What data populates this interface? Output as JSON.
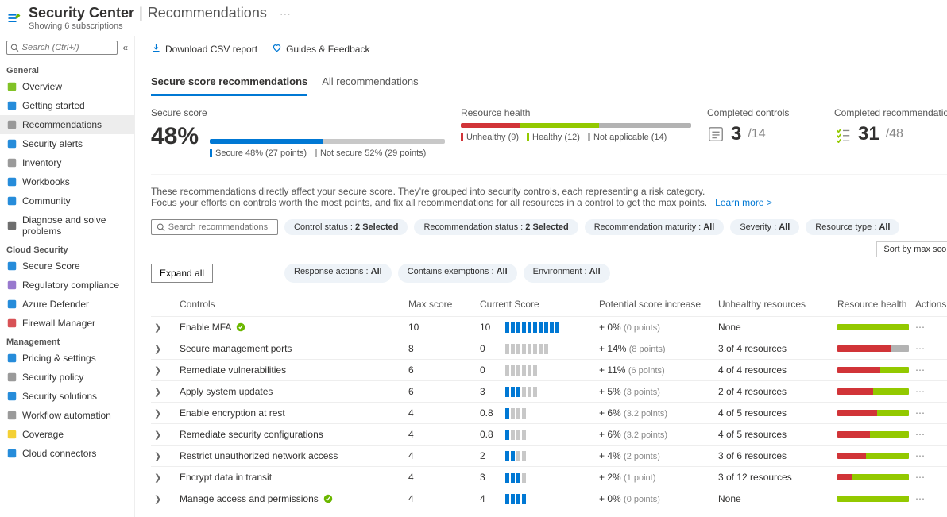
{
  "header": {
    "product": "Security Center",
    "page": "Recommendations",
    "subtitle": "Showing 6 subscriptions"
  },
  "search": {
    "placeholder": "Search (Ctrl+/)"
  },
  "sidebar": {
    "groups": [
      {
        "label": "General",
        "items": [
          {
            "label": "Overview",
            "icon": "shield",
            "color": "#6bb700"
          },
          {
            "label": "Getting started",
            "icon": "rocket",
            "color": "#0078d4"
          },
          {
            "label": "Recommendations",
            "icon": "list",
            "color": "#888",
            "active": true
          },
          {
            "label": "Security alerts",
            "icon": "shield-alert",
            "color": "#0078d4"
          },
          {
            "label": "Inventory",
            "icon": "box",
            "color": "#888"
          },
          {
            "label": "Workbooks",
            "icon": "book",
            "color": "#0078d4"
          },
          {
            "label": "Community",
            "icon": "people",
            "color": "#0078d4"
          },
          {
            "label": "Diagnose and solve problems",
            "icon": "wrench",
            "color": "#555"
          }
        ]
      },
      {
        "label": "Cloud Security",
        "items": [
          {
            "label": "Secure Score",
            "icon": "shield-check",
            "color": "#0078d4"
          },
          {
            "label": "Regulatory compliance",
            "icon": "badge",
            "color": "#8661c5"
          },
          {
            "label": "Azure Defender",
            "icon": "defender",
            "color": "#0078d4"
          },
          {
            "label": "Firewall Manager",
            "icon": "firewall",
            "color": "#d13438"
          }
        ]
      },
      {
        "label": "Management",
        "items": [
          {
            "label": "Pricing & settings",
            "icon": "sliders",
            "color": "#0078d4"
          },
          {
            "label": "Security policy",
            "icon": "gear",
            "color": "#888"
          },
          {
            "label": "Security solutions",
            "icon": "grid",
            "color": "#0078d4"
          },
          {
            "label": "Workflow automation",
            "icon": "flow",
            "color": "#888"
          },
          {
            "label": "Coverage",
            "icon": "coverage",
            "color": "#f2c811"
          },
          {
            "label": "Cloud connectors",
            "icon": "cloud",
            "color": "#0078d4"
          }
        ]
      }
    ]
  },
  "toolbar": {
    "download": "Download CSV report",
    "guides": "Guides & Feedback"
  },
  "tabs": [
    {
      "label": "Secure score recommendations",
      "active": true
    },
    {
      "label": "All recommendations",
      "active": false
    }
  ],
  "summary": {
    "secureScore": {
      "title": "Secure score",
      "value": "48%",
      "securePct": 48,
      "secureLabel": "Secure 48% (27 points)",
      "notSecureLabel": "Not secure 52% (29 points)"
    },
    "resourceHealth": {
      "title": "Resource health",
      "unhealthy": {
        "label": "Unhealthy (9)",
        "val": 9
      },
      "healthy": {
        "label": "Healthy (12)",
        "val": 12
      },
      "na": {
        "label": "Not applicable (14)",
        "val": 14
      }
    },
    "completedControls": {
      "title": "Completed controls",
      "num": "3",
      "den": "/14"
    },
    "completedRecs": {
      "title": "Completed recommendations",
      "num": "31",
      "den": "/48"
    }
  },
  "descLine1": "These recommendations directly affect your secure score. They're grouped into security controls, each representing a risk category.",
  "descLine2": "Focus your efforts on controls worth the most points, and fix all recommendations for all resources in a control to get the max points.",
  "learnMore": "Learn more >",
  "filterSearch": "Search recommendations",
  "expandAll": "Expand all",
  "pills": [
    {
      "label": "Control status :",
      "value": "2 Selected"
    },
    {
      "label": "Recommendation status :",
      "value": "2 Selected"
    },
    {
      "label": "Recommendation maturity :",
      "value": "All"
    },
    {
      "label": "Severity :",
      "value": "All"
    },
    {
      "label": "Resource type :",
      "value": "All"
    }
  ],
  "pills2": [
    {
      "label": "Response actions :",
      "value": "All"
    },
    {
      "label": "Contains exemptions :",
      "value": "All"
    },
    {
      "label": "Environment :",
      "value": "All"
    }
  ],
  "sort": "Sort by max score",
  "columns": {
    "controls": "Controls",
    "max": "Max score",
    "current": "Current Score",
    "potential": "Potential score increase",
    "unhealthy": "Unhealthy resources",
    "rh": "Resource health",
    "actions": "Actions"
  },
  "rows": [
    {
      "name": "Enable MFA",
      "completed": true,
      "max": 10,
      "curText": "10",
      "curFill": 10,
      "curTotal": 10,
      "potPct": "+ 0%",
      "potPts": "(0 points)",
      "unhealthy": "None",
      "rh": {
        "red": 0,
        "green": 100,
        "gray": 0
      }
    },
    {
      "name": "Secure management ports",
      "max": 8,
      "curText": "0",
      "curFill": 0,
      "curTotal": 8,
      "potPct": "+ 14%",
      "potPts": "(8 points)",
      "unhealthy": "3 of 4 resources",
      "rh": {
        "red": 75,
        "green": 0,
        "gray": 25
      }
    },
    {
      "name": "Remediate vulnerabilities",
      "max": 6,
      "curText": "0",
      "curFill": 0,
      "curTotal": 6,
      "potPct": "+ 11%",
      "potPts": "(6 points)",
      "unhealthy": "4 of 4 resources",
      "rh": {
        "red": 60,
        "green": 40,
        "gray": 0
      }
    },
    {
      "name": "Apply system updates",
      "max": 6,
      "curText": "3",
      "curFill": 3,
      "curTotal": 6,
      "potPct": "+ 5%",
      "potPts": "(3 points)",
      "unhealthy": "2 of 4 resources",
      "rh": {
        "red": 50,
        "green": 50,
        "gray": 0
      }
    },
    {
      "name": "Enable encryption at rest",
      "max": 4,
      "curText": "0.8",
      "curFill": 1,
      "curTotal": 4,
      "potPct": "+ 6%",
      "potPts": "(3.2 points)",
      "unhealthy": "4 of 5 resources",
      "rh": {
        "red": 55,
        "green": 45,
        "gray": 0
      }
    },
    {
      "name": "Remediate security configurations",
      "max": 4,
      "curText": "0.8",
      "curFill": 1,
      "curTotal": 4,
      "potPct": "+ 6%",
      "potPts": "(3.2 points)",
      "unhealthy": "4 of 5 resources",
      "rh": {
        "red": 45,
        "green": 55,
        "gray": 0
      }
    },
    {
      "name": "Restrict unauthorized network access",
      "max": 4,
      "curText": "2",
      "curFill": 2,
      "curTotal": 4,
      "potPct": "+ 4%",
      "potPts": "(2 points)",
      "unhealthy": "3 of 6 resources",
      "rh": {
        "red": 40,
        "green": 60,
        "gray": 0
      }
    },
    {
      "name": "Encrypt data in transit",
      "max": 4,
      "curText": "3",
      "curFill": 3,
      "curTotal": 4,
      "potPct": "+ 2%",
      "potPts": "(1 point)",
      "unhealthy": "3 of 12 resources",
      "rh": {
        "red": 20,
        "green": 80,
        "gray": 0
      }
    },
    {
      "name": "Manage access and permissions",
      "completed": true,
      "max": 4,
      "curText": "4",
      "curFill": 4,
      "curTotal": 4,
      "potPct": "+ 0%",
      "potPts": "(0 points)",
      "unhealthy": "None",
      "rh": {
        "red": 0,
        "green": 100,
        "gray": 0
      }
    }
  ]
}
